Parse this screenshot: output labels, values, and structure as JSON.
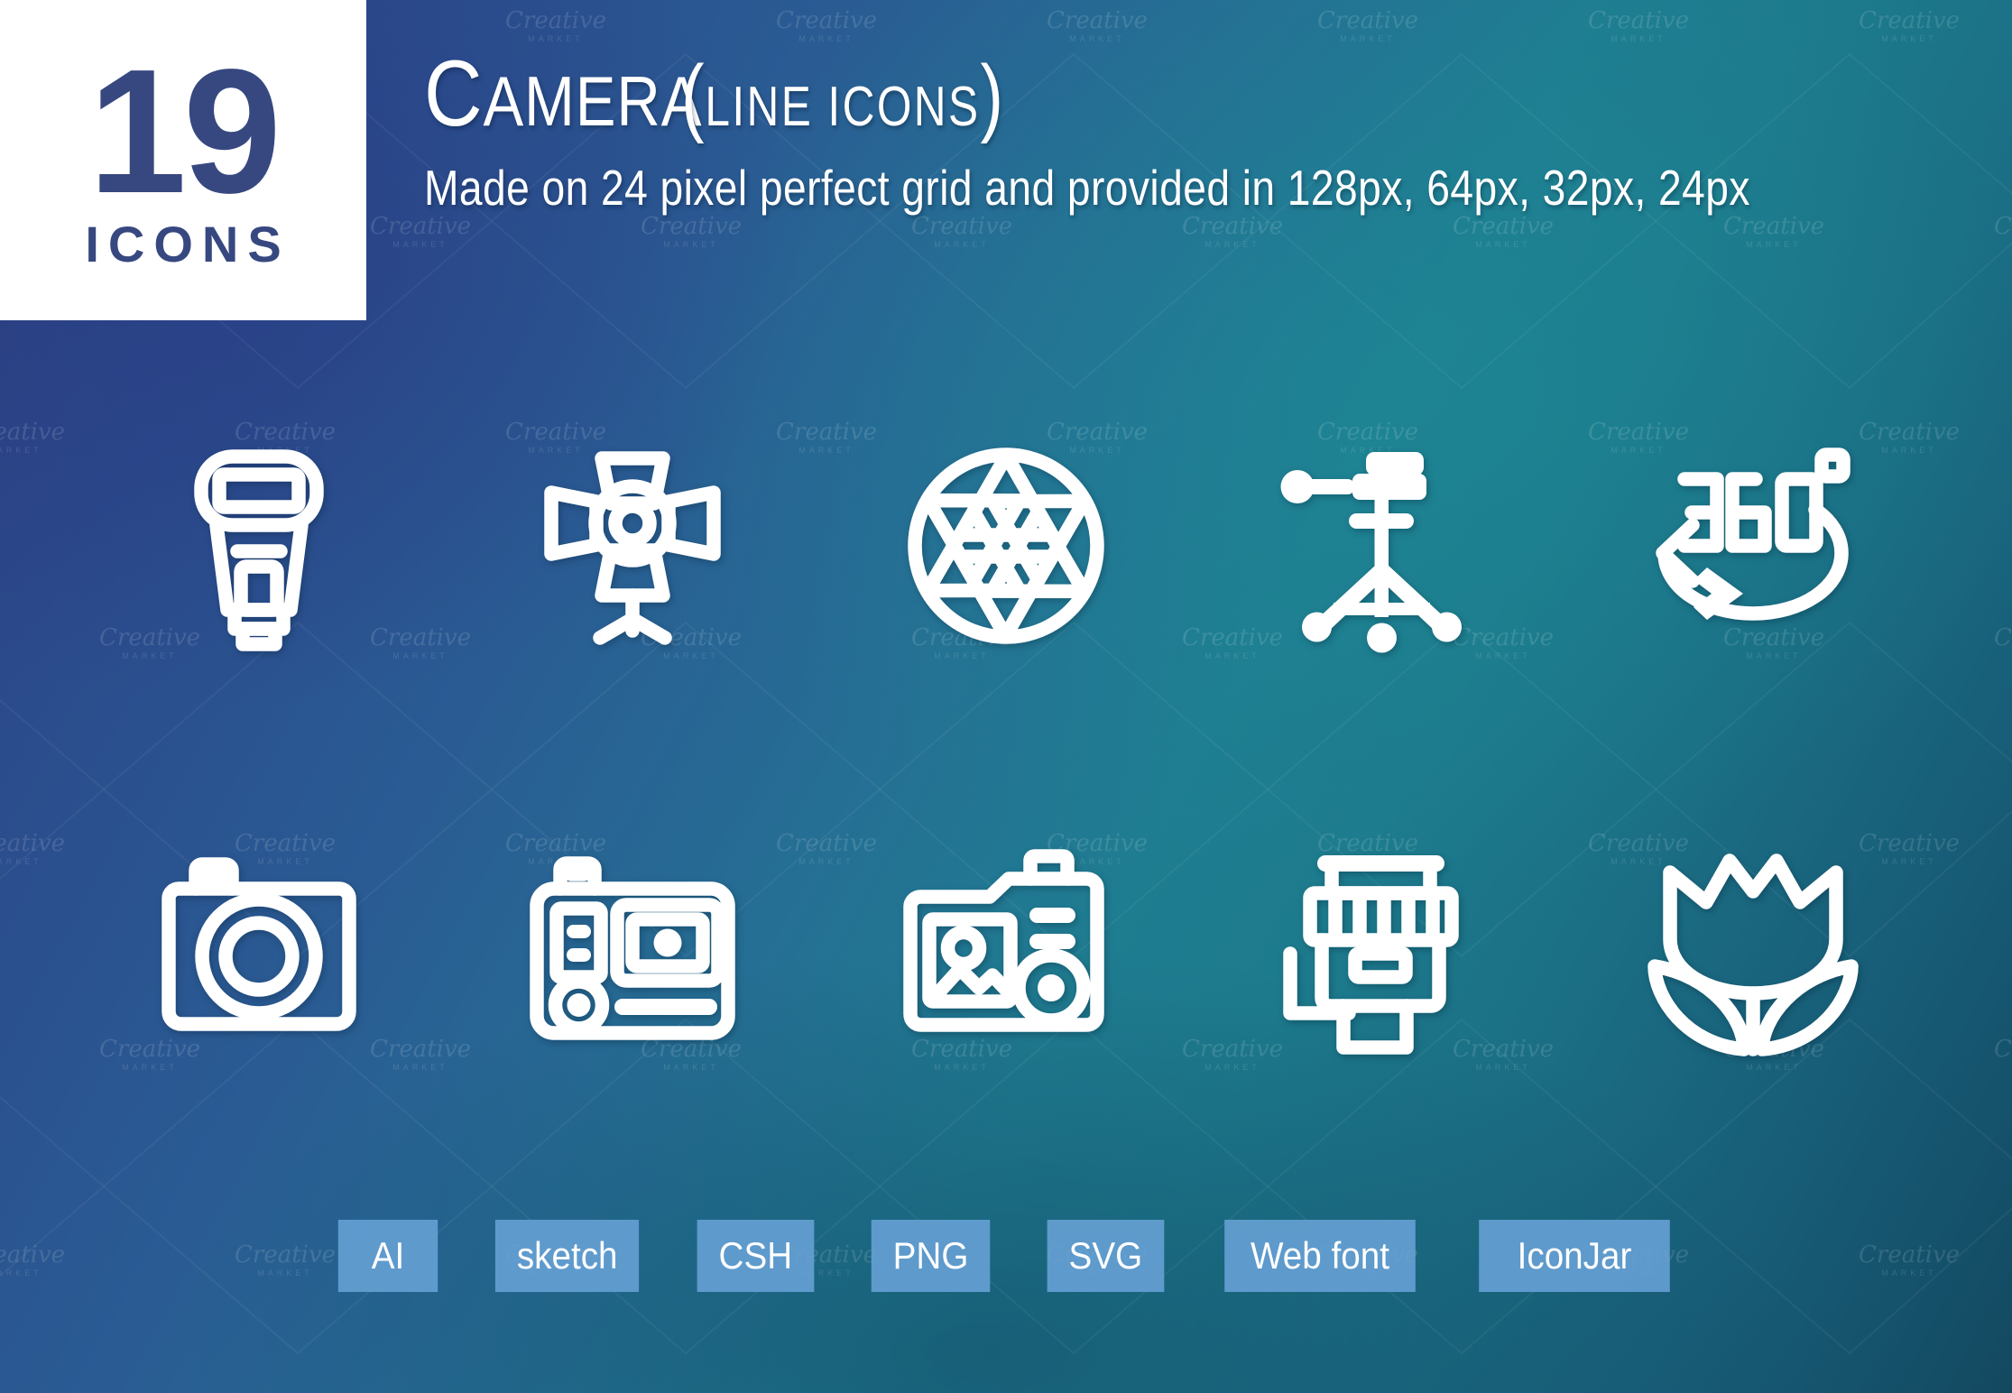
{
  "badge": {
    "count": "19",
    "label": "ICONS"
  },
  "header": {
    "title_first_letter": "C",
    "title_rest": "AMERA",
    "title_paren_open": "(",
    "title_paren_text": "LINE ICONS",
    "title_paren_close": ")",
    "title_full": "Camera (line icons)",
    "subtitle": "Made on 24 pixel perfect grid and provided in 128px, 64px, 32px, 24px"
  },
  "colors": {
    "badge_text": "#374880",
    "badge_bg": "#ffffff",
    "icon_stroke": "#ffffff",
    "tag_bg": "#68a2d6",
    "gradient_start": "#2e3f7f",
    "gradient_mid": "#1f7d91",
    "gradient_end": "#134960"
  },
  "icons": [
    {
      "id": "camera-flash",
      "name": "Camera flash",
      "row": 1,
      "col": 1
    },
    {
      "id": "studio-light",
      "name": "Studio light",
      "row": 1,
      "col": 2
    },
    {
      "id": "aperture-shutter",
      "name": "Aperture shutter",
      "row": 1,
      "col": 3
    },
    {
      "id": "tripod",
      "name": "Tripod",
      "row": 1,
      "col": 4
    },
    {
      "id": "360-degrees",
      "name": "360 degrees",
      "row": 1,
      "col": 5,
      "label": "360"
    },
    {
      "id": "photo-camera",
      "name": "Photo camera",
      "row": 2,
      "col": 1
    },
    {
      "id": "action-camera",
      "name": "Action camera",
      "row": 2,
      "col": 2
    },
    {
      "id": "camera-with-photo",
      "name": "Camera with photo",
      "row": 2,
      "col": 3
    },
    {
      "id": "camera-lens",
      "name": "Camera lens",
      "row": 2,
      "col": 4
    },
    {
      "id": "flower-macro",
      "name": "Flower macro",
      "row": 2,
      "col": 5
    }
  ],
  "formats": [
    {
      "label": "AI",
      "wide": false
    },
    {
      "label": "sketch",
      "wide": false
    },
    {
      "label": "CSH",
      "wide": false
    },
    {
      "label": "PNG",
      "wide": false
    },
    {
      "label": "SVG",
      "wide": false
    },
    {
      "label": "Web font",
      "wide": true
    },
    {
      "label": "IconJar",
      "wide": true
    }
  ],
  "watermark": {
    "line1": "Creative",
    "line2": "MARKET"
  }
}
